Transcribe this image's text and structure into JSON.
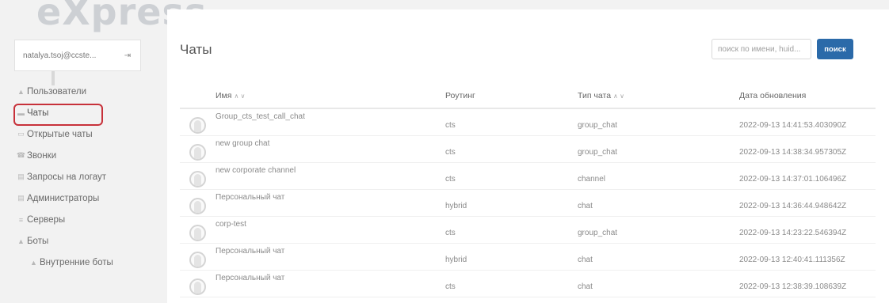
{
  "app": {
    "logo": "eXpress"
  },
  "user": {
    "name": "natalya.tsoj@ccste..."
  },
  "sidebar": {
    "items": [
      {
        "label": "Пользователи",
        "icon": "user-icon"
      },
      {
        "label": "Чаты",
        "icon": "chat-icon",
        "active": true
      },
      {
        "label": "Открытые чаты",
        "icon": "open-chat-icon"
      },
      {
        "label": "Звонки",
        "icon": "phone-icon"
      },
      {
        "label": "Запросы на логаут",
        "icon": "logout-request-icon"
      },
      {
        "label": "Администраторы",
        "icon": "admin-icon"
      },
      {
        "label": "Серверы",
        "icon": "server-icon"
      },
      {
        "label": "Боты",
        "icon": "bots-icon"
      },
      {
        "label": "Внутренние боты",
        "icon": "internal-bot-icon",
        "sub": true
      }
    ]
  },
  "main": {
    "title": "Чаты",
    "search": {
      "placeholder": "поиск по имени, huid...",
      "button": "поиск"
    },
    "table": {
      "headers": {
        "name": "Имя",
        "routing": "Роутинг",
        "type": "Тип чата",
        "date": "Дата обновления"
      },
      "rows": [
        {
          "name": "Group_cts_test_call_chat",
          "routing": "cts",
          "type": "group_chat",
          "date": "2022-09-13 14:41:53.403090Z"
        },
        {
          "name": "new group chat",
          "routing": "cts",
          "type": "group_chat",
          "date": "2022-09-13 14:38:34.957305Z"
        },
        {
          "name": "new corporate channel",
          "routing": "cts",
          "type": "channel",
          "date": "2022-09-13 14:37:01.106496Z"
        },
        {
          "name": "Персональный чат",
          "routing": "hybrid",
          "type": "chat",
          "date": "2022-09-13 14:36:44.948642Z"
        },
        {
          "name": "corp-test",
          "routing": "cts",
          "type": "group_chat",
          "date": "2022-09-13 14:23:22.546394Z"
        },
        {
          "name": "Персональный чат",
          "routing": "hybrid",
          "type": "chat",
          "date": "2022-09-13 12:40:41.111356Z"
        },
        {
          "name": "Персональный чат",
          "routing": "cts",
          "type": "chat",
          "date": "2022-09-13 12:38:39.108639Z"
        }
      ]
    }
  },
  "colors": {
    "accent": "#2b6aa9",
    "highlight": "#c7313a"
  }
}
